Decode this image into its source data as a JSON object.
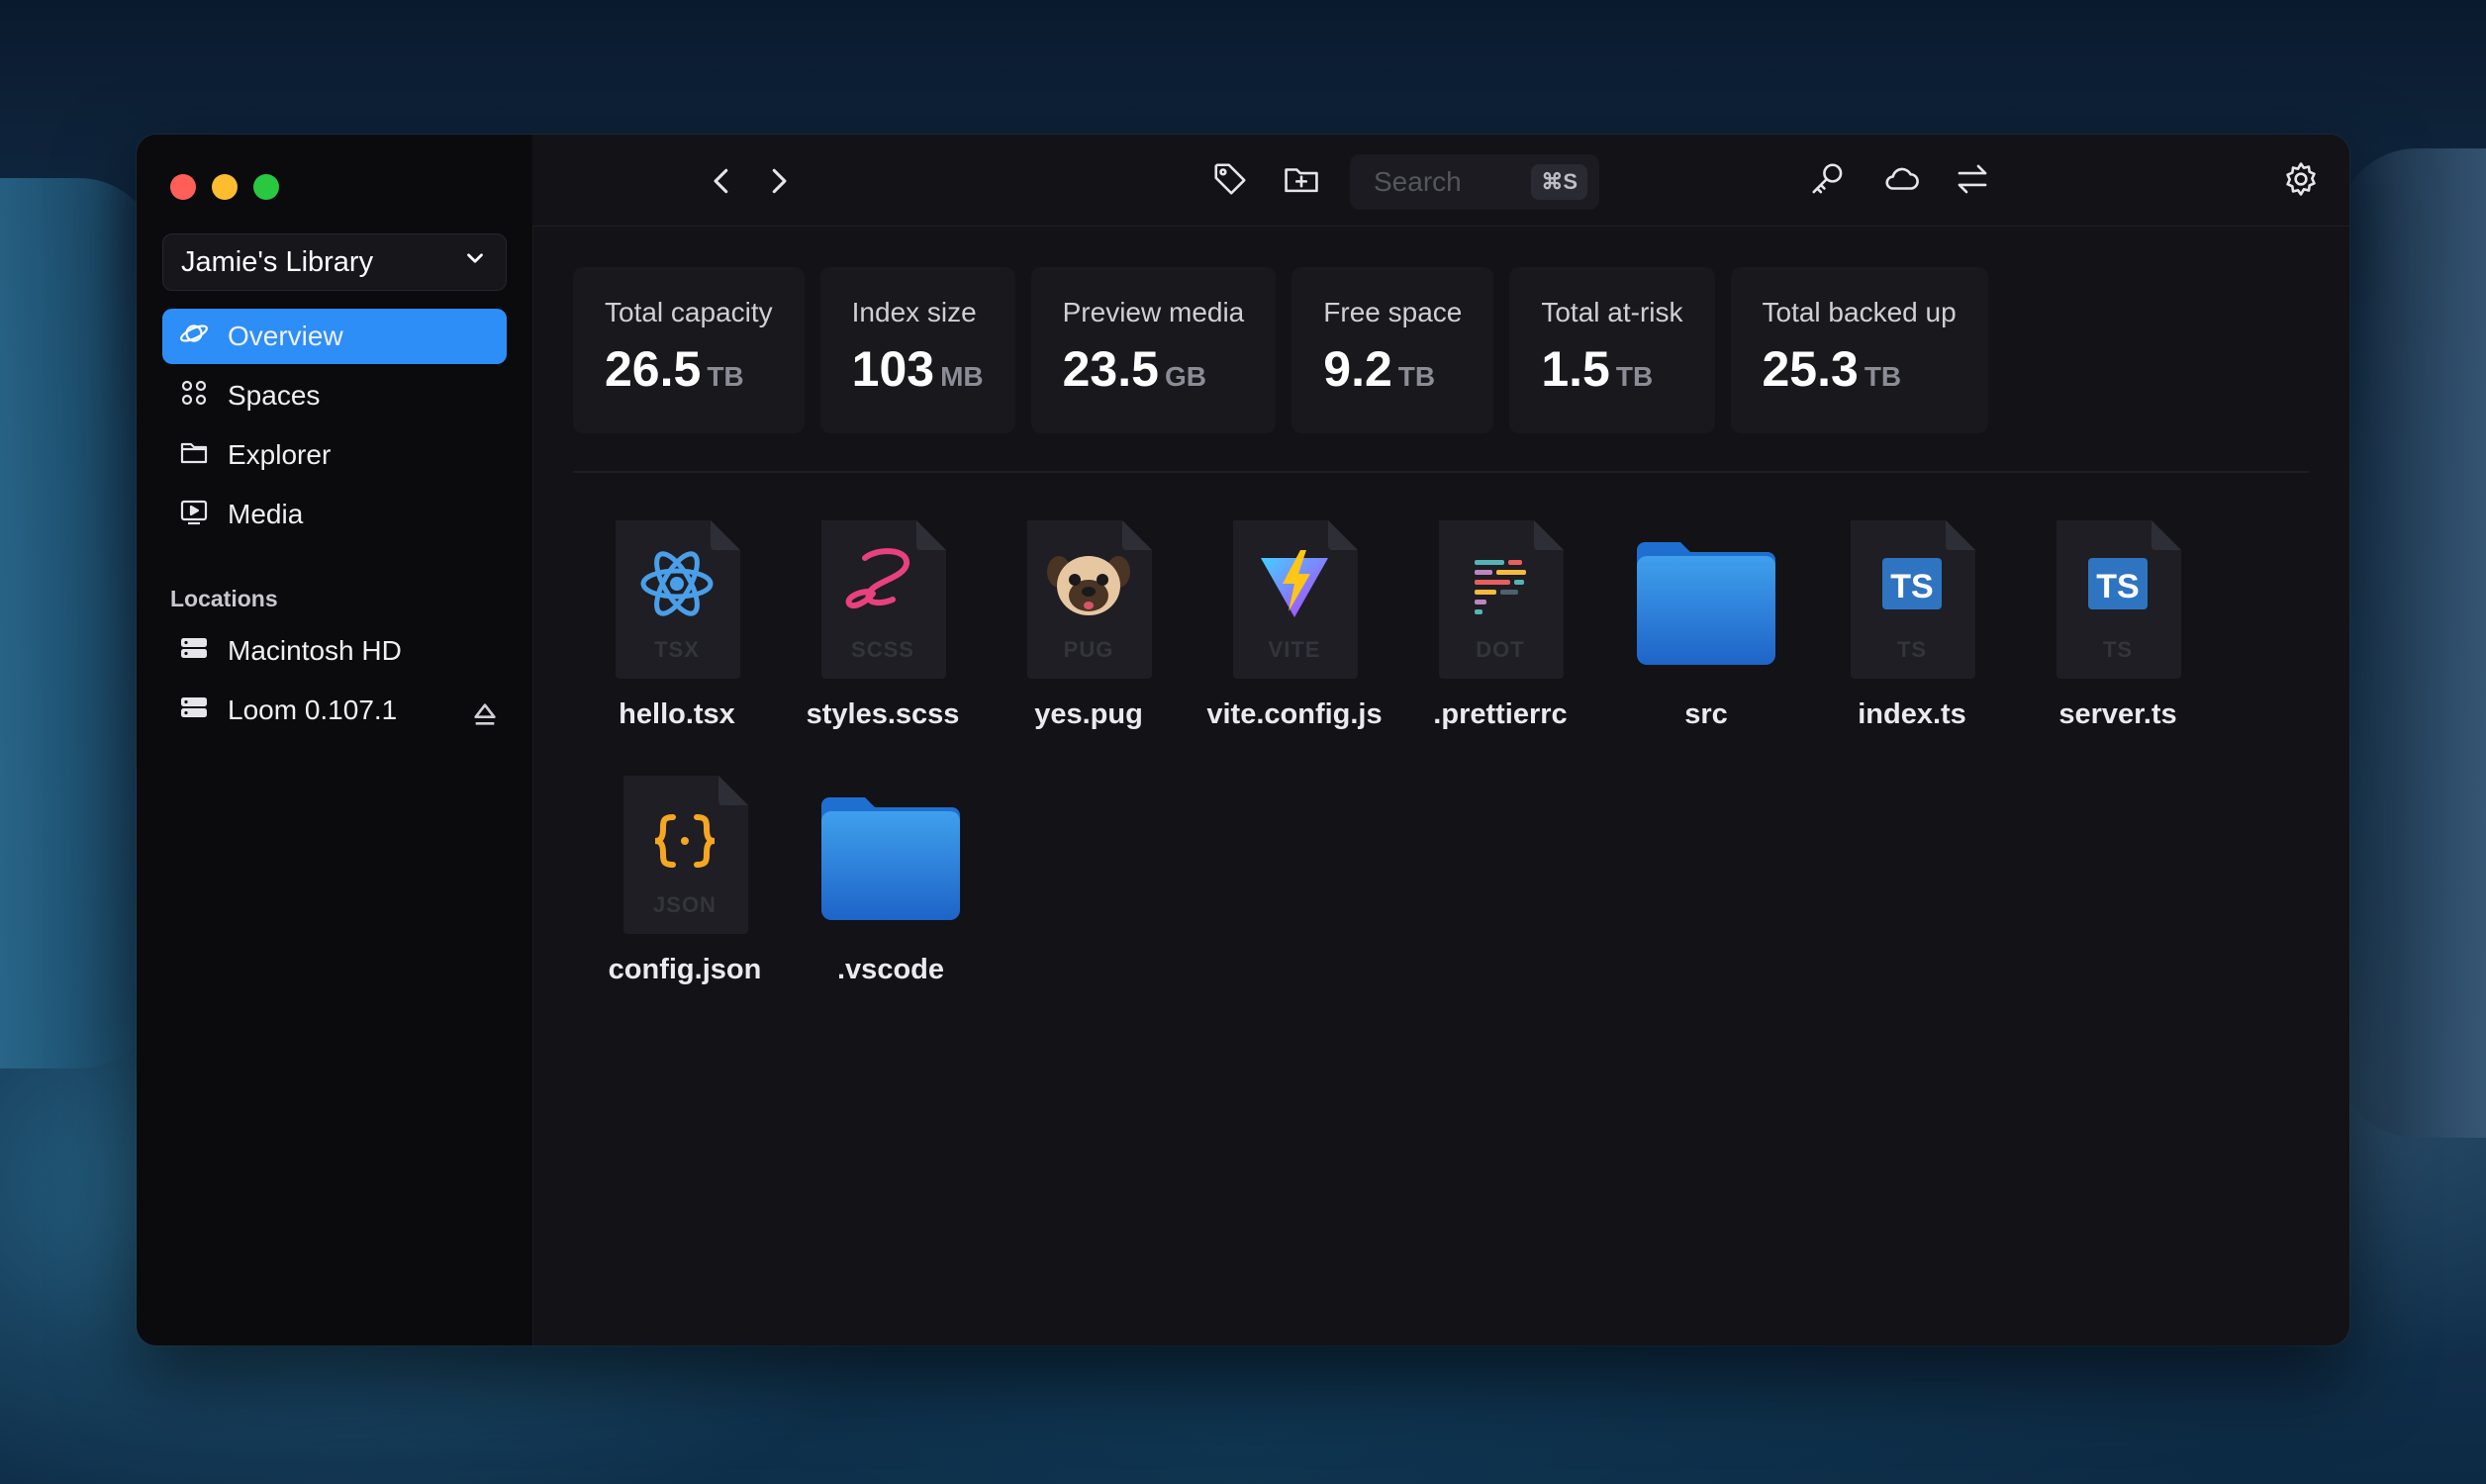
{
  "sidebar": {
    "library": "Jamie's Library",
    "nav": [
      {
        "label": "Overview",
        "icon": "planet-icon",
        "active": true
      },
      {
        "label": "Spaces",
        "icon": "grid-icon",
        "active": false
      },
      {
        "label": "Explorer",
        "icon": "folder-icon",
        "active": false
      },
      {
        "label": "Media",
        "icon": "media-icon",
        "active": false
      }
    ],
    "locations_header": "Locations",
    "locations": [
      {
        "label": "Macintosh HD",
        "icon": "drive-icon"
      },
      {
        "label": "Loom 0.107.1",
        "icon": "drive-icon",
        "ejectable": true
      }
    ]
  },
  "toolbar": {
    "search_placeholder": "Search",
    "search_shortcut": "⌘S"
  },
  "stats": [
    {
      "label": "Total capacity",
      "value": "26.5",
      "unit": "TB"
    },
    {
      "label": "Index size",
      "value": "103",
      "unit": "MB"
    },
    {
      "label": "Preview media",
      "value": "23.5",
      "unit": "GB"
    },
    {
      "label": "Free space",
      "value": "9.2",
      "unit": "TB"
    },
    {
      "label": "Total at-risk",
      "value": "1.5",
      "unit": "TB"
    },
    {
      "label": "Total backed up",
      "value": "25.3",
      "unit": "TB"
    }
  ],
  "files": [
    {
      "name": "hello.tsx",
      "kind": "doc",
      "badge": "TSX",
      "icon": "react-icon"
    },
    {
      "name": "styles.scss",
      "kind": "doc",
      "badge": "SCSS",
      "icon": "sass-icon"
    },
    {
      "name": "yes.pug",
      "kind": "doc",
      "badge": "PUG",
      "icon": "pug-icon"
    },
    {
      "name": "vite.config.js",
      "kind": "doc",
      "badge": "VITE",
      "icon": "vite-icon"
    },
    {
      "name": ".prettierrc",
      "kind": "doc",
      "badge": "DOT",
      "icon": "prettier-icon"
    },
    {
      "name": "src",
      "kind": "folder",
      "icon": "folder-icon"
    },
    {
      "name": "index.ts",
      "kind": "doc",
      "badge": "TS",
      "icon": "typescript-icon"
    },
    {
      "name": "server.ts",
      "kind": "doc",
      "badge": "TS",
      "icon": "typescript-icon"
    },
    {
      "name": "config.json",
      "kind": "doc",
      "badge": "JSON",
      "icon": "json-icon"
    },
    {
      "name": ".vscode",
      "kind": "folder",
      "icon": "folder-icon"
    }
  ],
  "colors": {
    "accent": "#2d8ef8",
    "traffic_red": "#ff5f57",
    "traffic_yellow": "#febc2e",
    "traffic_green": "#28c840"
  }
}
